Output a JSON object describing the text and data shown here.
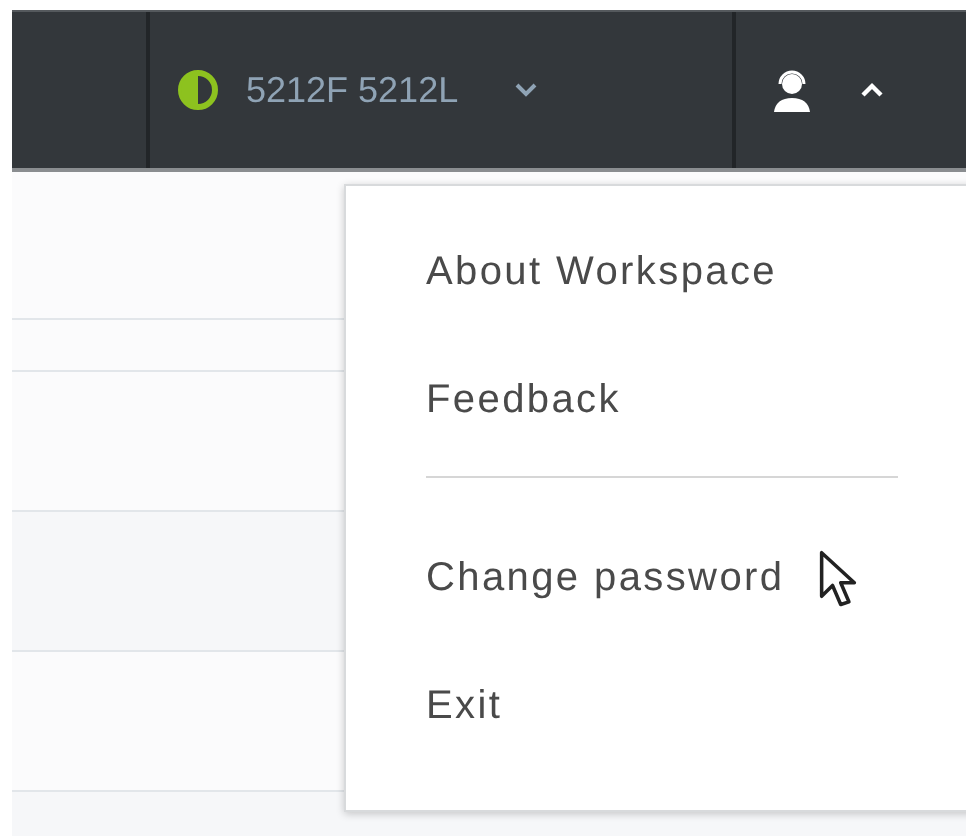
{
  "top_bar": {
    "agent_name": "5212F 5212L",
    "user_menu_expanded": true
  },
  "user_menu": {
    "items": [
      {
        "label": "About Workspace",
        "kind": "item",
        "hovered": false
      },
      {
        "label": "Feedback",
        "kind": "item",
        "hovered": false
      },
      {
        "kind": "separator"
      },
      {
        "label": "Change password",
        "kind": "item",
        "hovered": true
      },
      {
        "label": "Exit",
        "kind": "item",
        "hovered": false
      }
    ]
  }
}
